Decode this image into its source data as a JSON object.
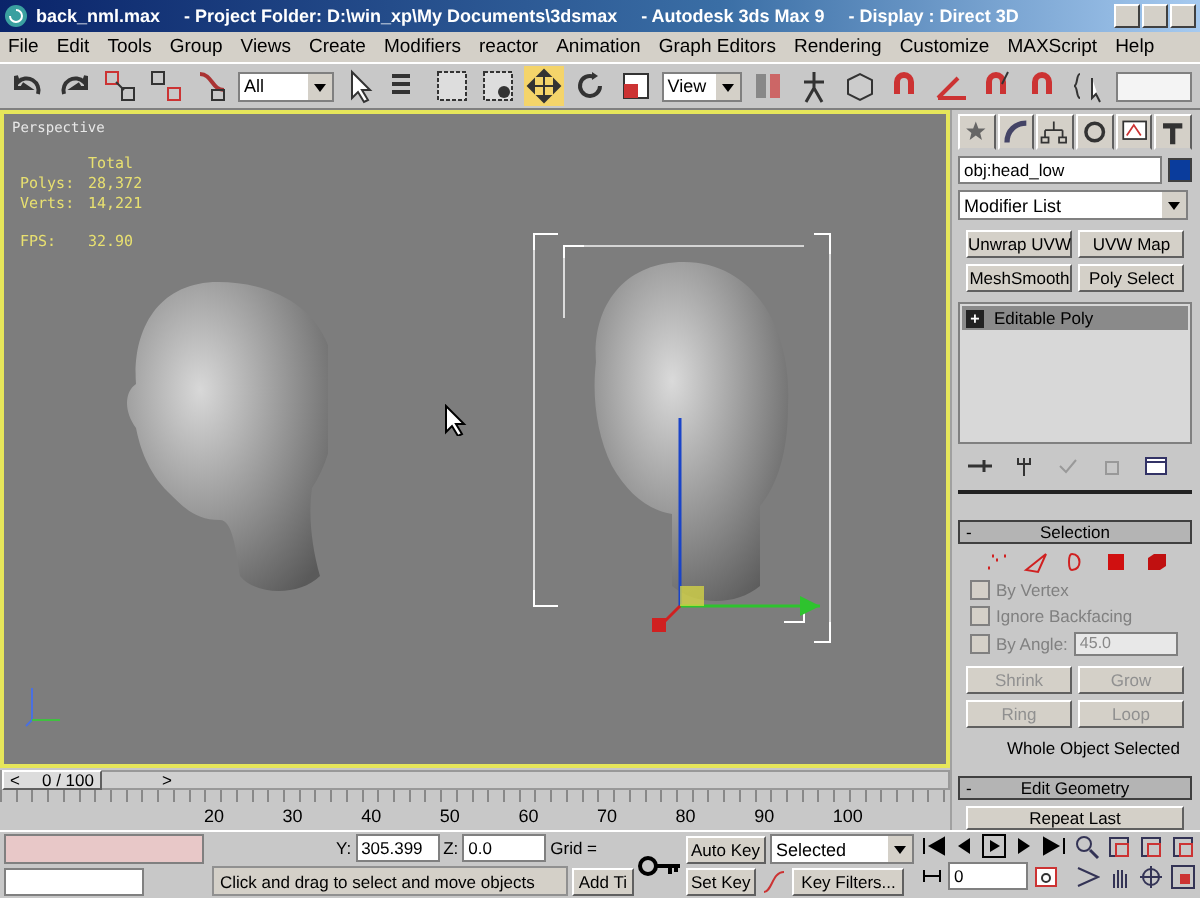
{
  "window": {
    "title_parts": [
      "back_nml.max",
      "- Project Folder: D:\\win_xp\\My Documents\\3dsmax",
      "- Autodesk 3ds Max 9",
      "- Display : Direct 3D"
    ]
  },
  "menu": [
    "File",
    "Edit",
    "Tools",
    "Group",
    "Views",
    "Create",
    "Modifiers",
    "reactor",
    "Animation",
    "Graph Editors",
    "Rendering",
    "Customize",
    "MAXScript",
    "Help"
  ],
  "toolbar": {
    "selection_filter": "All",
    "reference_coordinate": "View"
  },
  "viewport": {
    "label": "Perspective",
    "stats_heading": "Total",
    "stats": [
      {
        "label": "Polys:",
        "value": "28,372"
      },
      {
        "label": "Verts:",
        "value": "14,221"
      }
    ],
    "fps": {
      "label": "FPS:",
      "value": "32.90"
    }
  },
  "command_panel": {
    "object": {
      "name": "obj:head_low",
      "color": "#0a3c9c"
    },
    "modifier_list": "Modifier List",
    "modifier_buttons": [
      "Unwrap UVW",
      "UVW Map",
      "MeshSmooth",
      "Poly Select"
    ],
    "stack": [
      {
        "label": "Editable Poly",
        "expander": "+",
        "selected": true
      }
    ],
    "selection_rollout": {
      "expander": "-",
      "title": "Selection",
      "options": [
        {
          "label": "By Vertex",
          "checked": false
        },
        {
          "label": "Ignore Backfacing",
          "checked": false
        },
        {
          "label": "By Angle:",
          "checked": false,
          "value": "45.0"
        }
      ],
      "buttons": [
        {
          "label": "Shrink",
          "disabled": true
        },
        {
          "label": "Grow",
          "disabled": true
        },
        {
          "label": "Ring",
          "disabled": true
        },
        {
          "label": "Loop",
          "disabled": true
        }
      ],
      "status": "Whole Object Selected"
    },
    "edit_geometry_rollout": {
      "expander": "-",
      "title": "Edit Geometry",
      "button": "Repeat Last"
    }
  },
  "time_slider": {
    "level": 0,
    "prev": "<",
    "position": "0 / 100",
    "next": ">"
  },
  "track_bar": {
    "labels": [
      "20",
      "30",
      "40",
      "50",
      "60",
      "70",
      "80",
      "90",
      "100"
    ]
  },
  "status_bar": {
    "y_label": "Y:",
    "y_value": "305.399",
    "z_label": "Z:",
    "z_value": "0.0",
    "grid": "Grid =",
    "prompt": "Click and drag to select and move objects",
    "add_time_tag": "Add Ti",
    "auto_key": "Auto Key",
    "set_key": "Set Key",
    "key_mode": "Selected",
    "key_filters": "Key Filters...",
    "frame": "0"
  }
}
